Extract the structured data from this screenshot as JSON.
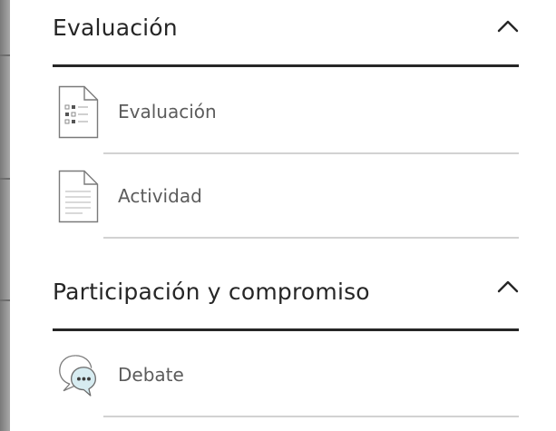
{
  "sections": [
    {
      "title": "Evaluación",
      "items": [
        {
          "label": "Evaluación",
          "icon": "assessment-document-icon"
        },
        {
          "label": "Actividad",
          "icon": "document-icon"
        }
      ]
    },
    {
      "title": "Participación y compromiso",
      "items": [
        {
          "label": "Debate",
          "icon": "discussion-bubbles-icon"
        }
      ]
    }
  ],
  "colors": {
    "heading": "#262626",
    "label": "#5c5c5c",
    "divider": "#d2d2d2",
    "accent_bubble": "#d7ecf1"
  }
}
